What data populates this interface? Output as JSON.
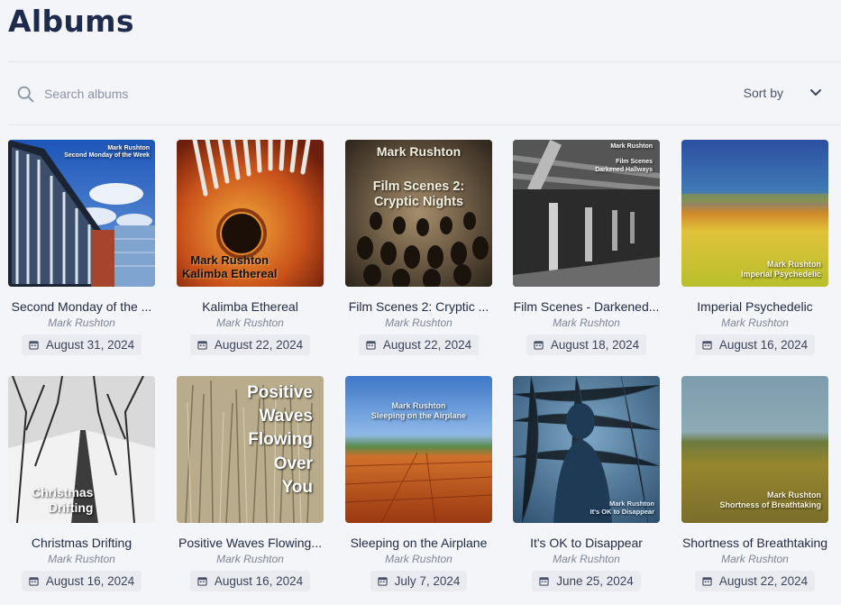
{
  "page": {
    "title": "Albums"
  },
  "search": {
    "placeholder": "Search albums",
    "icon": "search-icon"
  },
  "sort": {
    "label": "Sort by",
    "icon": "chevron-down-icon"
  },
  "albums": [
    {
      "title": "Second Monday of the ...",
      "artist": "Mark Rushton",
      "date": "August 31, 2024",
      "cover_lines": [
        "Mark Rushton",
        "Second Monday of the Week"
      ]
    },
    {
      "title": "Kalimba Ethereal",
      "artist": "Mark Rushton",
      "date": "August 22, 2024",
      "cover_lines": [
        "Mark Rushton",
        "Kalimba Ethereal"
      ]
    },
    {
      "title": "Film Scenes 2: Cryptic ...",
      "artist": "Mark Rushton",
      "date": "August 22, 2024",
      "cover_lines": [
        "Mark Rushton",
        "Film Scenes 2:",
        "Cryptic Nights"
      ]
    },
    {
      "title": "Film Scenes - Darkened...",
      "artist": "Mark Rushton",
      "date": "August 18, 2024",
      "cover_lines": [
        "Mark Rushton",
        "Film Scenes",
        "Darkened Hallways"
      ]
    },
    {
      "title": "Imperial Psychedelic",
      "artist": "Mark Rushton",
      "date": "August 16, 2024",
      "cover_lines": [
        "Mark Rushton",
        "Imperial Psychedelic"
      ]
    },
    {
      "title": "Christmas Drifting",
      "artist": "Mark Rushton",
      "date": "August 16, 2024",
      "cover_lines": [
        "Christmas",
        "Drifting"
      ]
    },
    {
      "title": "Positive Waves Flowing...",
      "artist": "Mark Rushton",
      "date": "August 16, 2024",
      "cover_lines": [
        "Positive",
        "Waves",
        "Flowing",
        "Over",
        "You"
      ]
    },
    {
      "title": "Sleeping on the Airplane",
      "artist": "Mark Rushton",
      "date": "July 7, 2024",
      "cover_lines": [
        "Mark Rushton",
        "Sleeping on the Airplane"
      ]
    },
    {
      "title": "It's OK to Disappear",
      "artist": "Mark Rushton",
      "date": "June 25, 2024",
      "cover_lines": [
        "Mark Rushton",
        "It's OK to Disappear"
      ]
    },
    {
      "title": "Shortness of Breathtaking",
      "artist": "Mark Rushton",
      "date": "August 22, 2024",
      "cover_lines": [
        "Mark Rushton",
        "Shortness of Breathtaking"
      ]
    }
  ],
  "icons": {
    "date": "calendar-icon"
  },
  "colors": {
    "title": "#1e2b4d",
    "background": "#f4f5f8",
    "date_badge": "#e9ebf0"
  }
}
